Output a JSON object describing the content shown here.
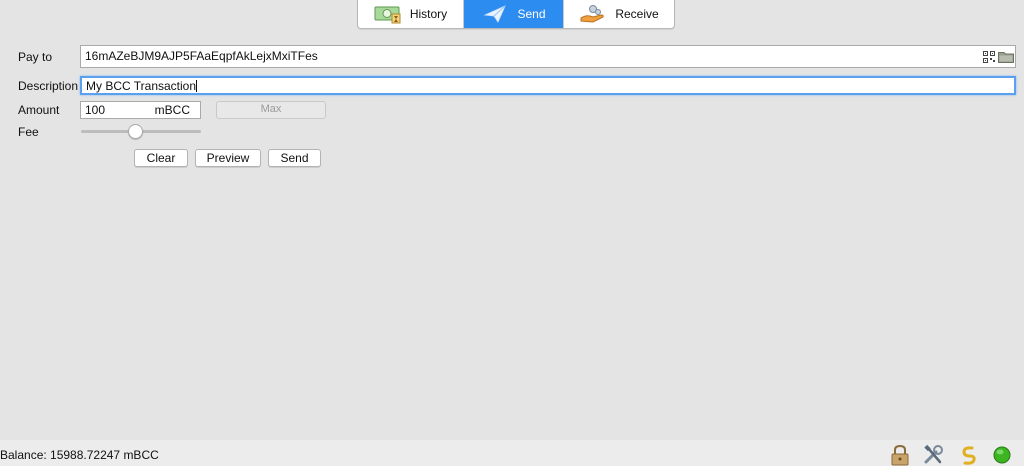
{
  "tabs": [
    {
      "label": "History",
      "icon": "history-icon",
      "active": false
    },
    {
      "label": "Send",
      "icon": "send-icon",
      "active": true
    },
    {
      "label": "Receive",
      "icon": "receive-icon",
      "active": false
    }
  ],
  "form": {
    "pay_to_label": "Pay to",
    "pay_to_value": "16mAZeBJM9AJP5FAaEqpfAkLejxMxiTFes",
    "description_label": "Description",
    "description_value": "My BCC Transaction",
    "amount_label": "Amount",
    "amount_value": "100",
    "amount_unit": "mBCC",
    "max_label": "Max",
    "fee_label": "Fee",
    "fee_slider_level": 0.45
  },
  "buttons": {
    "clear": "Clear",
    "preview": "Preview",
    "send": "Send"
  },
  "status": {
    "balance": "Balance: 15988.72247 mBCC",
    "icons": [
      "lock-icon",
      "tools-icon",
      "seed-icon",
      "network-status-icon"
    ]
  },
  "colors": {
    "active_tab": "#2d8cf0",
    "focus_ring": "#5aa0ef",
    "status_ok": "#3cb521"
  }
}
